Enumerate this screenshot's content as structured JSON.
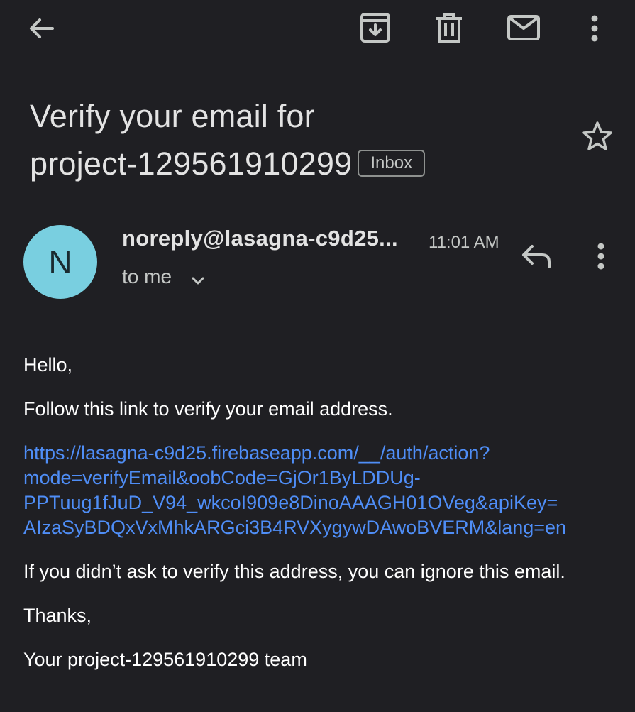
{
  "toolbar": {
    "back_icon": "arrow-back-icon",
    "archive_icon": "archive-icon",
    "delete_icon": "trash-icon",
    "mark_unread_icon": "mail-icon",
    "more_icon": "more-vert-icon"
  },
  "email": {
    "subject_line1": "Verify your email for",
    "subject_line2": "project-129561910299",
    "label": "Inbox",
    "sender_initial": "N",
    "sender": "noreply@lasagna-c9d25...",
    "time": "11:01 AM",
    "recipient": "to me",
    "body": {
      "greeting": "Hello,",
      "instruction": "Follow this link to verify your email address.",
      "link_line1": "https://lasagna-c9d25.firebaseapp.com/__/auth/action?",
      "link_line2": "mode=verifyEmail&oobCode=GjOr1ByLDDUg-",
      "link_line3": "PPTuug1fJuD_V94_wkcoI909e8DinoAAAGH01OVeg&apiKey=",
      "link_line4": "AIzaSyBDQxVxMhkARGci3B4RVXygywDAwoBVERM&lang=en",
      "ignore_note": "If you didn’t ask to verify this address, you can ignore this email.",
      "signoff": "Thanks,",
      "signature": "Your project-129561910299 team"
    }
  },
  "colors": {
    "background": "#1f1f23",
    "avatar": "#79cfe0",
    "link": "#4f8ef7"
  }
}
